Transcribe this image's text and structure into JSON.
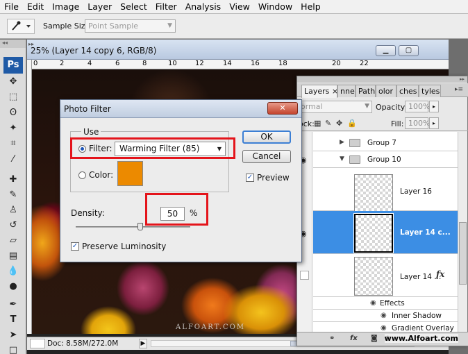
{
  "menu": [
    "File",
    "Edit",
    "Image",
    "Layer",
    "Select",
    "Filter",
    "Analysis",
    "View",
    "Window",
    "Help"
  ],
  "options": {
    "sample_size_label": "Sample Size:",
    "sample_size_value": "Point Sample"
  },
  "tools": {
    "logo": "Ps"
  },
  "document": {
    "title": "25% (Layer 14 copy 6, RGB/8)",
    "ruler_numbers": [
      "0",
      "2",
      "4",
      "6",
      "8",
      "10",
      "12",
      "14",
      "16",
      "18",
      "20",
      "22"
    ],
    "canvas_watermark": "ALFOART.COM",
    "status_info": "Doc: 8.58M/272.0M"
  },
  "dialog": {
    "title": "Photo Filter",
    "close_label": "✕",
    "use_label": "Use",
    "filter_label": "Filter:",
    "filter_value": "Warming Filter (85)",
    "color_label": "Color:",
    "swatch_color": "#ec8a00",
    "density_label": "Density:",
    "density_value": "50",
    "density_unit": "%",
    "density_fraction": 0.5,
    "preserve_label": "Preserve Luminosity",
    "preserve_checked": true,
    "ok_label": "OK",
    "cancel_label": "Cancel",
    "preview_label": "Preview",
    "preview_checked": true,
    "highlight_color": "#e4141b"
  },
  "layers_panel": {
    "tabs": [
      "Layers",
      "nnels",
      "Paths",
      "olor",
      "ches",
      "tyles"
    ],
    "tab_close": "×",
    "blend_mode": "ormal",
    "opacity_label": "Opacity:",
    "opacity_value": "100%",
    "lock_label": "ock:",
    "fill_label": "Fill:",
    "fill_value": "100%",
    "rows": [
      {
        "name": "Group 7",
        "kind": "group"
      },
      {
        "name": "Group 10",
        "kind": "group"
      },
      {
        "name": "Layer 16",
        "kind": "layer"
      },
      {
        "name": "Layer 14 c...",
        "kind": "layer",
        "selected": true
      },
      {
        "name": "Layer 14 ...",
        "kind": "layer",
        "fx": "fx"
      }
    ],
    "effects": [
      "Effects",
      "Inner Shadow",
      "Gradient Overlay"
    ],
    "footer_fx": "fx",
    "site_watermark": "www.Alfoart.com"
  }
}
